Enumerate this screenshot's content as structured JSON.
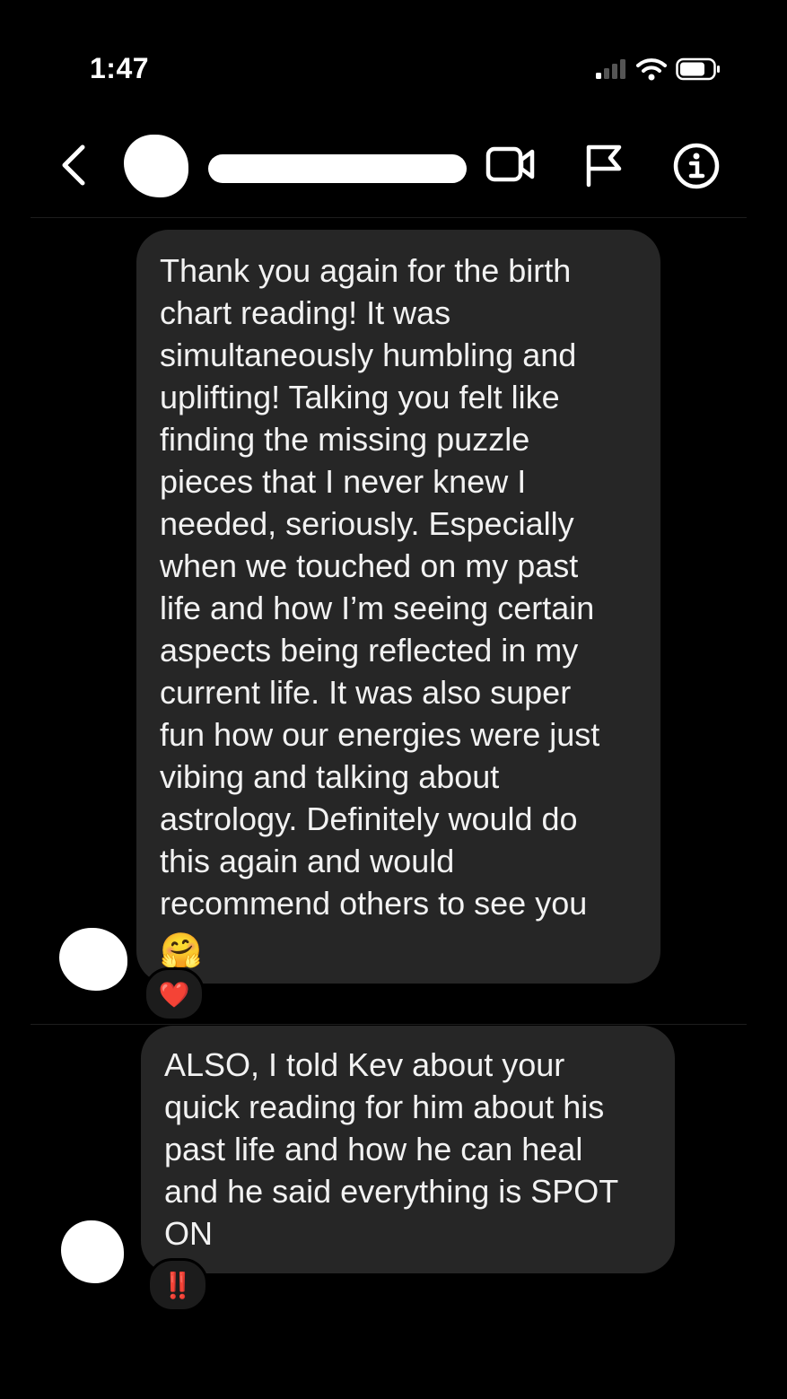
{
  "status_bar": {
    "time": "1:47",
    "signal_icon": "cellular-signal-icon",
    "wifi_icon": "wifi-icon",
    "battery_icon": "battery-icon"
  },
  "header": {
    "back_icon": "chevron-left-icon",
    "avatar": "redacted-avatar",
    "username": "redacted-username",
    "video_icon": "video-camera-icon",
    "flag_icon": "flag-icon",
    "info_icon": "info-icon"
  },
  "messages": [
    {
      "text": "Thank you  again for the birth\nchart reading! It was\nsimultaneously humbling and\nuplifting! Talking you felt like\nfinding the missing puzzle\npieces that I never knew I\nneeded, seriously. Especially\nwhen we touched on my past\nlife and how I’m seeing certain\naspects being reflected in my\ncurrent life. It was also super\nfun how our energies were just\nvibing and talking about\nastrology. Definitely would do\nthis again and would\nrecommend others to see you",
      "emoji": "🤗",
      "reaction": "❤️"
    },
    {
      "text": "ALSO, I told Kev about your\nquick reading for him about his\npast life and how he can heal\nand he said everything is SPOT\nON",
      "reaction": "‼️"
    }
  ],
  "colors": {
    "background": "#000000",
    "bubble": "#262626",
    "text": "#f2f2f2",
    "heart": "#e0233a",
    "double_exclamation": "#d42a2a"
  }
}
